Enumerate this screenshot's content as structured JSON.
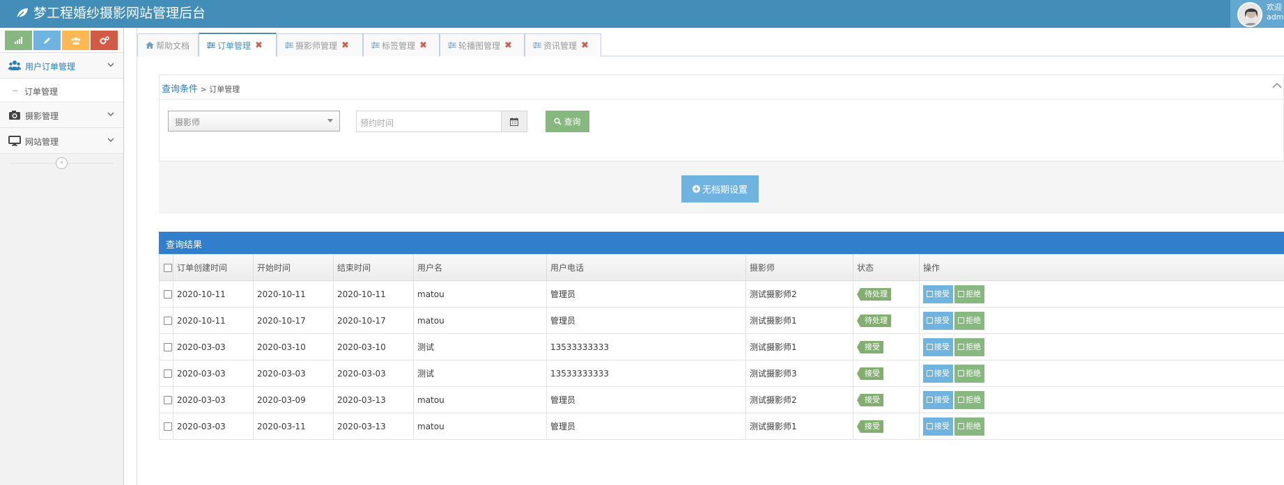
{
  "app": {
    "title": "梦工程婚纱摄影网站管理后台"
  },
  "user": {
    "welcome": "欢迎",
    "name": "admin"
  },
  "colors": {
    "navbar": "#438eb9",
    "accent": "#307ecc",
    "success": "#87b87f",
    "info": "#6fb3e0",
    "danger": "#d15b47",
    "warning": "#ffb752"
  },
  "shortcuts": [
    {
      "icon": "signal-icon",
      "color": "#87b87f"
    },
    {
      "icon": "pencil-icon",
      "color": "#6fb3e0"
    },
    {
      "icon": "users-icon",
      "color": "#ffb752"
    },
    {
      "icon": "cogs-icon",
      "color": "#d15b47"
    }
  ],
  "sidebar": {
    "items": [
      {
        "label": "用户订单管理",
        "icon": "users-icon",
        "expanded": true
      },
      {
        "label": "订单管理"
      },
      {
        "label": "摄影管理",
        "icon": "camera-icon"
      },
      {
        "label": "网站管理",
        "icon": "desktop-icon"
      }
    ]
  },
  "tabs": [
    {
      "label": "帮助文档",
      "icon": "home-icon"
    },
    {
      "label": "订单管理",
      "icon": "sliders-icon",
      "active": true
    },
    {
      "label": "摄影师管理",
      "icon": "sliders-icon"
    },
    {
      "label": "标签管理",
      "icon": "sliders-icon"
    },
    {
      "label": "轮播图管理",
      "icon": "sliders-icon"
    },
    {
      "label": "资讯管理",
      "icon": "sliders-icon"
    }
  ],
  "query": {
    "title": "查询条件",
    "breadcrumb": " > 订单管理",
    "photographer_placeholder": "摄影师",
    "date_placeholder": "预约时间",
    "search_label": "查询"
  },
  "no_schedule_label": "无档期设置",
  "results": {
    "title": "查询结果",
    "columns": [
      "订单创建时间",
      "开始时间",
      "结束时间",
      "用户名",
      "用户电话",
      "摄影师",
      "状态",
      "操作"
    ],
    "accept_label": "接受",
    "reject_label": "拒绝",
    "rows": [
      [
        "2020-10-11",
        "2020-10-11",
        "2020-10-11",
        "matou",
        "管理员",
        "测试摄影师2",
        "待处理"
      ],
      [
        "2020-10-11",
        "2020-10-17",
        "2020-10-17",
        "matou",
        "管理员",
        "测试摄影师1",
        "待处理"
      ],
      [
        "2020-03-03",
        "2020-03-10",
        "2020-03-10",
        "测试",
        "13533333333",
        "测试摄影师1",
        "接受"
      ],
      [
        "2020-03-03",
        "2020-03-03",
        "2020-03-03",
        "测试",
        "13533333333",
        "测试摄影师3",
        "接受"
      ],
      [
        "2020-03-03",
        "2020-03-09",
        "2020-03-13",
        "matou",
        "管理员",
        "测试摄影师2",
        "接受"
      ],
      [
        "2020-03-03",
        "2020-03-11",
        "2020-03-13",
        "matou",
        "管理员",
        "测试摄影师1",
        "接受"
      ]
    ]
  }
}
